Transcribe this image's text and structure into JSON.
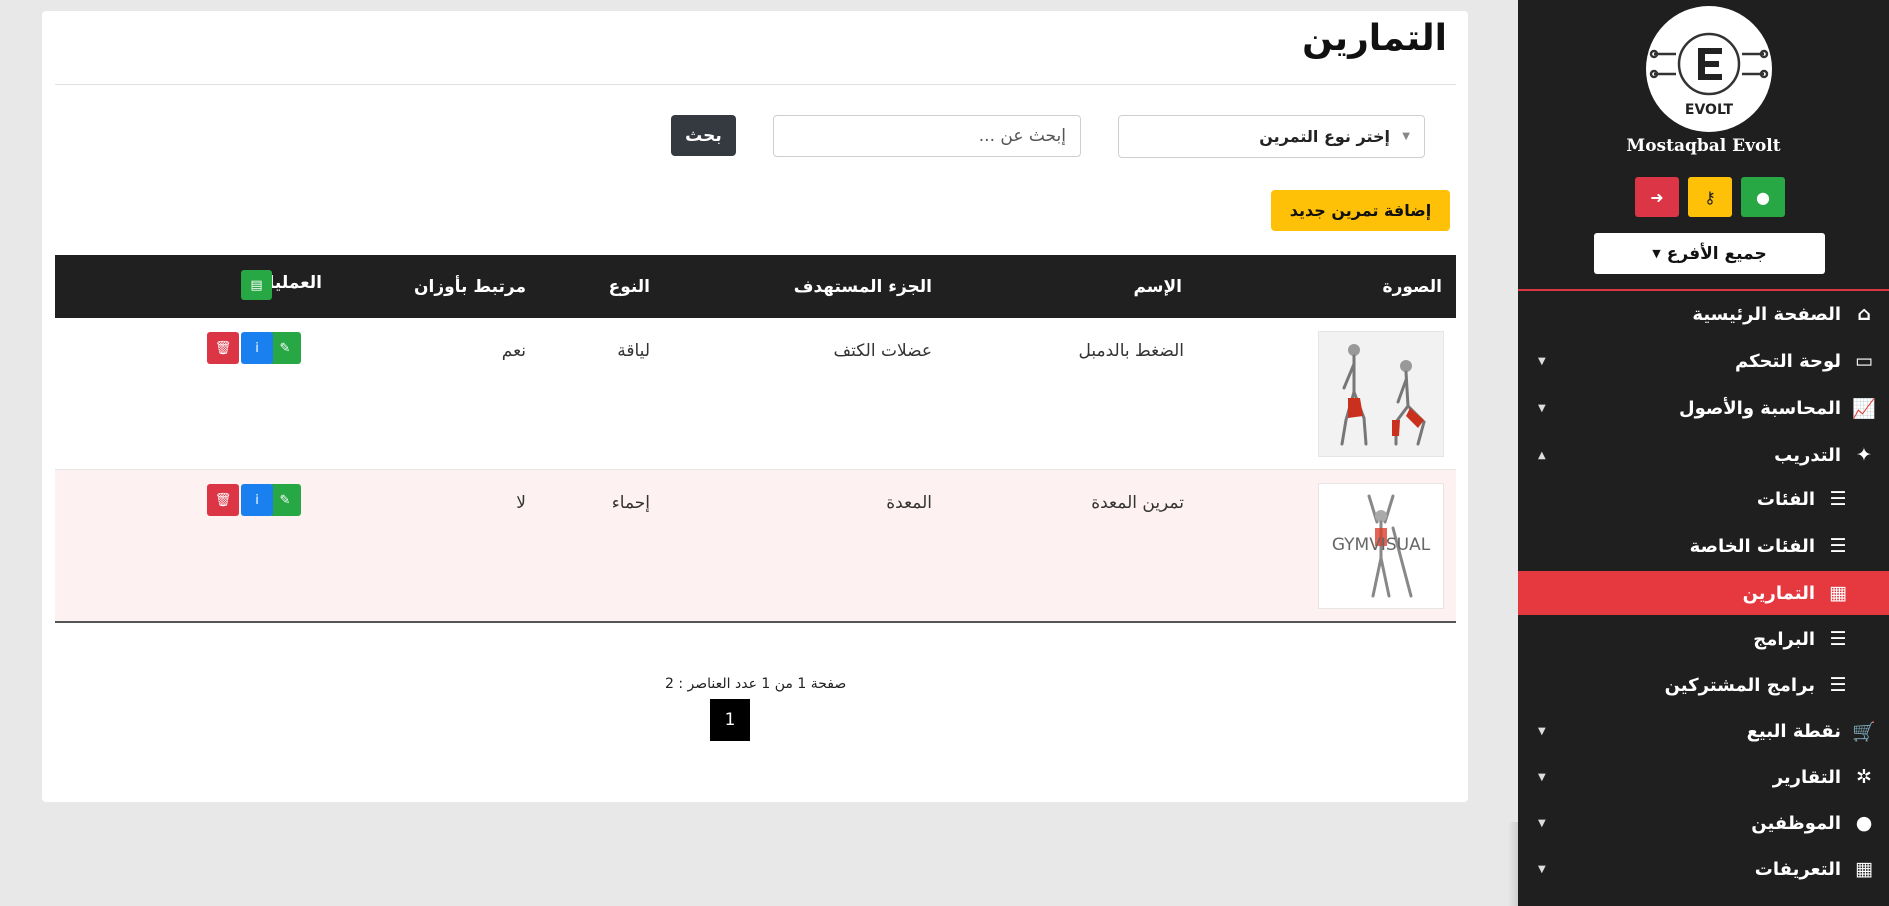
{
  "sidebar": {
    "logo_text": "EVOLT",
    "brand": "Mostaqbal Evolt",
    "branch_select": "جميع الأفرع",
    "icons": {
      "logout": "sign-out-icon",
      "key": "key-icon",
      "user": "user-icon"
    },
    "items": [
      {
        "label": "الصفحة الرئيسية",
        "icon": "home-icon",
        "glyph": "⌂",
        "arrow": ""
      },
      {
        "label": "لوحة التحكم",
        "icon": "laptop-icon",
        "glyph": "▭",
        "arrow": "▼"
      },
      {
        "label": "المحاسبة والأصول",
        "icon": "chart-line-icon",
        "glyph": "📈",
        "arrow": "▼"
      },
      {
        "label": "التدريب",
        "icon": "magic-wand-icon",
        "glyph": "✦",
        "arrow": "▲"
      },
      {
        "label": "الفئات",
        "icon": "list-icon",
        "glyph": "☰",
        "arrow": ""
      },
      {
        "label": "الفئات الخاصة",
        "icon": "list-icon",
        "glyph": "☰",
        "arrow": ""
      },
      {
        "label": "التمارين",
        "icon": "calendar-icon",
        "glyph": "▦",
        "arrow": ""
      },
      {
        "label": "البرامج",
        "icon": "list-icon",
        "glyph": "☰",
        "arrow": ""
      },
      {
        "label": "برامج المشتركين",
        "icon": "list-icon",
        "glyph": "☰",
        "arrow": ""
      },
      {
        "label": "نقطة البيع",
        "icon": "cart-icon",
        "glyph": "🛒",
        "arrow": "▼"
      },
      {
        "label": "التقارير",
        "icon": "bug-icon",
        "glyph": "✲",
        "arrow": "▼"
      },
      {
        "label": "الموظفين",
        "icon": "user-icon",
        "glyph": "●",
        "arrow": "▼"
      },
      {
        "label": "التعريفات",
        "icon": "table-icon",
        "glyph": "▦",
        "arrow": "▼"
      }
    ]
  },
  "main": {
    "title": "التمارين",
    "type_select": "إختر نوع التمرين",
    "search_placeholder": "إبحث عن ...",
    "search_button": "بحث",
    "add_button": "إضافة تمرين جديد"
  },
  "table": {
    "headers": {
      "image": "الصورة",
      "name": "الإسم",
      "target": "الجزء المستهدف",
      "type": "النوع",
      "weights": "مرتبط بأوزان",
      "actions": "العمليات"
    },
    "rows": [
      {
        "name": "الضغط بالدمبل",
        "target": "عضلات الكتف",
        "type": "لياقة",
        "weights": "نعم",
        "image_caption": ""
      },
      {
        "name": "تمرين المعدة",
        "target": "المعدة",
        "type": "إحماء",
        "weights": "لا",
        "image_caption": "GYMVISUAL"
      }
    ]
  },
  "pagination": {
    "info": "صفحة 1 من 1 عدد العناصر : 2",
    "current_page": "1"
  },
  "colors": {
    "sidebar_bg": "#1f1f1f",
    "active": "#e5383f",
    "warning": "#ffc107",
    "success": "#28a745",
    "info": "#1a80f0",
    "danger": "#dc3545"
  }
}
